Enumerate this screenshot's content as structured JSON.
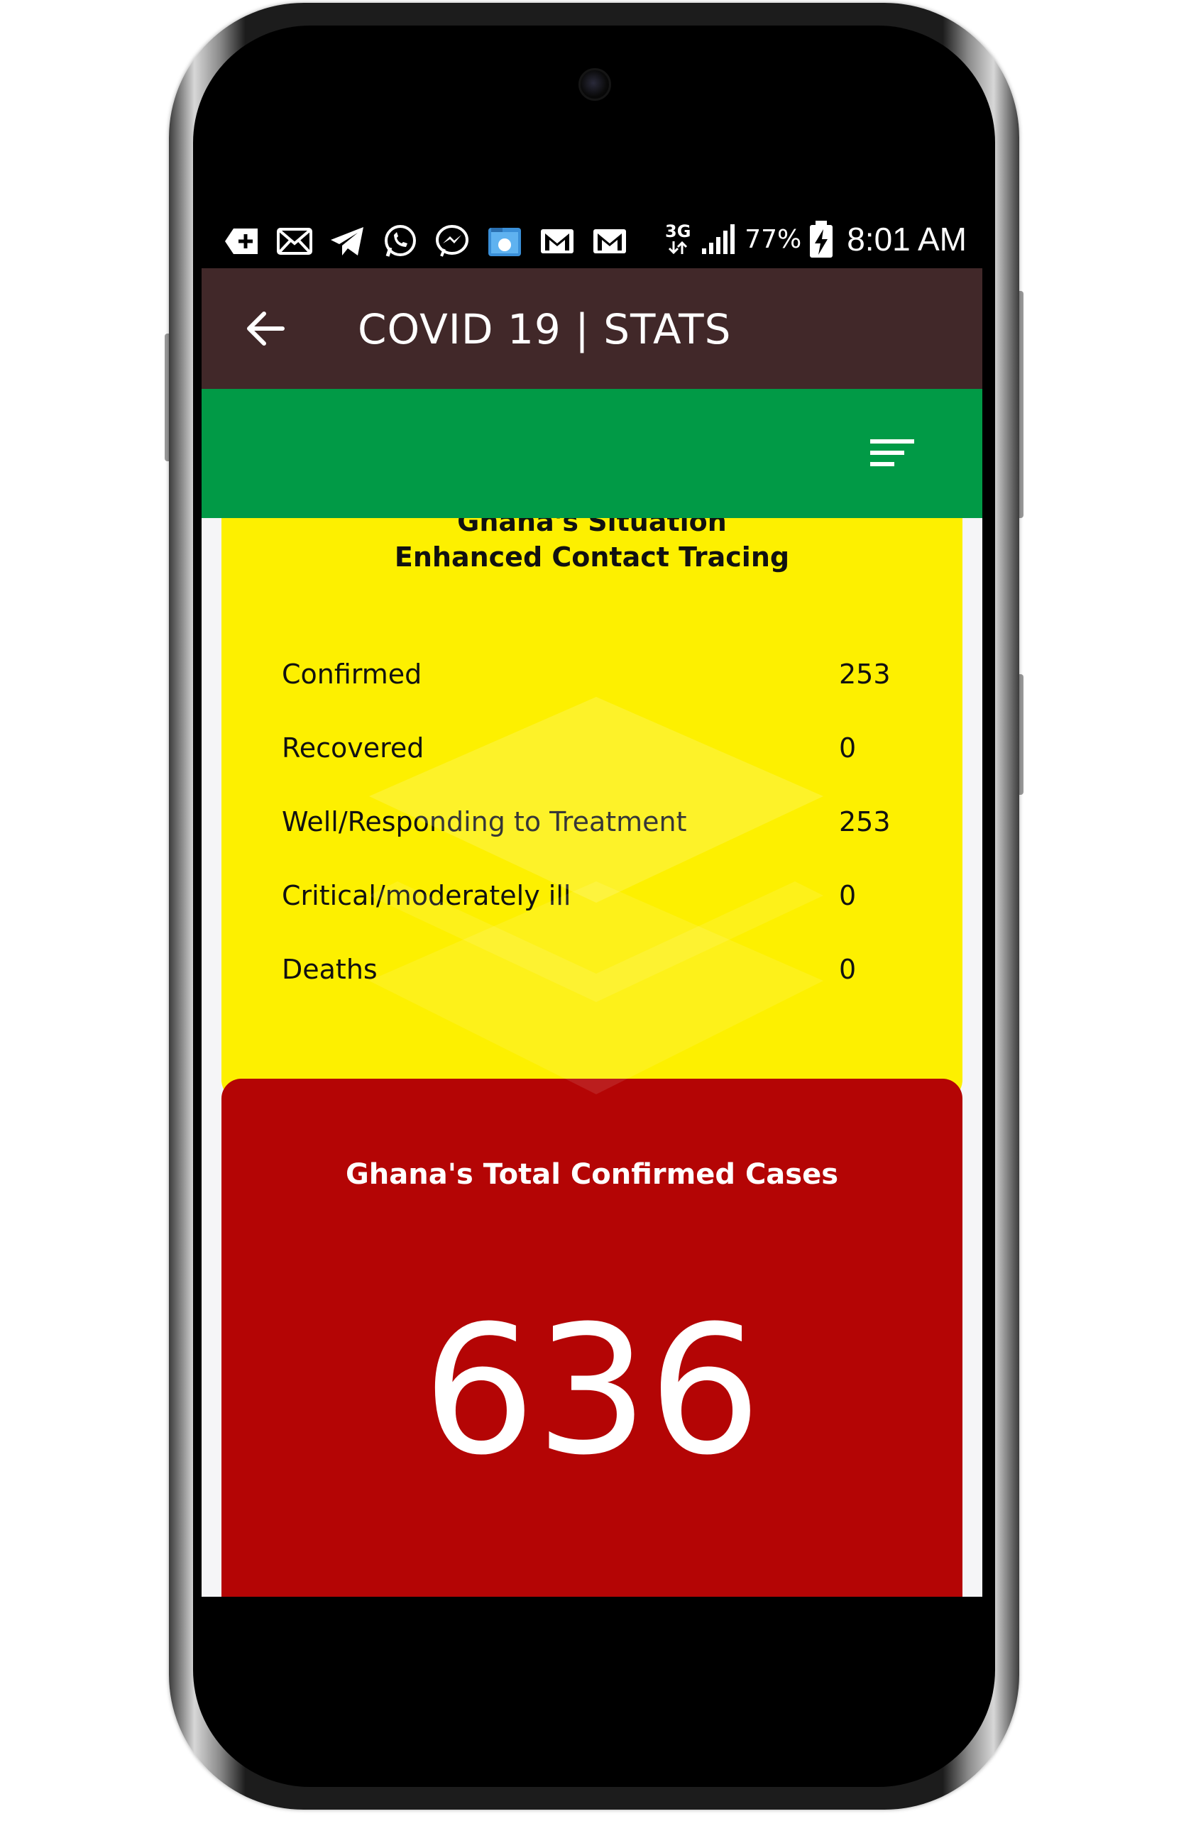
{
  "status_bar": {
    "notification_icons": [
      "add-box-icon",
      "email-icon",
      "telegram-icon",
      "whatsapp-icon",
      "messenger-icon",
      "file-manager-icon",
      "gmail-icon",
      "gmail-icon"
    ],
    "network_type": "3G",
    "battery_percent": "77%",
    "time": "8:01 AM"
  },
  "app_bar": {
    "title": "COVID 19 | STATS",
    "back_icon": "arrow-back-icon",
    "color": "#412829"
  },
  "sub_bar": {
    "color": "#019a46",
    "menu_icon": "sort-menu-icon"
  },
  "situation_card": {
    "title_line1": "Ghana's Situation",
    "title_line2": "Enhanced Contact Tracing",
    "color": "#fdf000",
    "rows": [
      {
        "label": "Confirmed",
        "value": "253"
      },
      {
        "label": "Recovered",
        "value": "0"
      },
      {
        "label": "Well/Responding to Treatment",
        "value": "253"
      },
      {
        "label": "Critical/moderately ill",
        "value": "0"
      },
      {
        "label": "Deaths",
        "value": "0"
      }
    ]
  },
  "total_card": {
    "title": "Ghana's Total Confirmed Cases",
    "value": "636",
    "color": "#b40505"
  }
}
